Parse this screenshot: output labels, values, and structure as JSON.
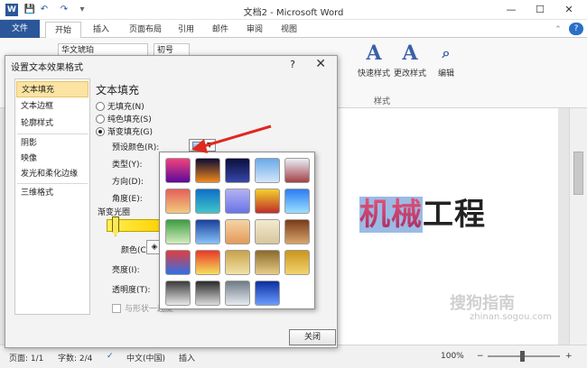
{
  "app": {
    "title": "文档2 - Microsoft Word",
    "word_icon": "W"
  },
  "qat": {
    "save_icon": "save-icon",
    "undo_icon": "undo-icon",
    "redo_icon": "redo-icon"
  },
  "window_controls": {
    "minimize": "—",
    "maximize": "☐",
    "close": "✕"
  },
  "tabs": [
    {
      "label": "文件"
    },
    {
      "label": "开始"
    },
    {
      "label": "插入"
    },
    {
      "label": "页面布局"
    },
    {
      "label": "引用"
    },
    {
      "label": "邮件"
    },
    {
      "label": "审阅"
    },
    {
      "label": "视图"
    }
  ],
  "ribbon": {
    "font_name": "华文琥珀",
    "font_size": "初号",
    "quick_styles": "快速样式",
    "change_styles": "更改样式",
    "edit": "编辑",
    "styles_group": "样式"
  },
  "document": {
    "text_part1": "机械",
    "text_part2": "工程",
    "gradient_colors": [
      "#e3557a",
      "#a52c62"
    ]
  },
  "dialog": {
    "title": "设置文本效果格式",
    "help": "?",
    "close_x": "✕",
    "nav": [
      {
        "label": "文本填充"
      },
      {
        "label": "文本边框"
      },
      {
        "label": "轮廓样式"
      },
      {
        "label": "阴影"
      },
      {
        "label": "映像"
      },
      {
        "label": "发光和柔化边缘"
      },
      {
        "label": "三维格式"
      }
    ],
    "section_title": "文本填充",
    "fill_options": [
      {
        "label": "无填充(N)"
      },
      {
        "label": "纯色填充(S)"
      },
      {
        "label": "渐变填充(G)",
        "selected": true
      }
    ],
    "preset_colors": "预设颜色(R):",
    "type": "类型(Y):",
    "direction": "方向(D):",
    "angle": "角度(E):",
    "gradient_stops": "渐变光圈",
    "color": "颜色(C)",
    "brightness": "亮度(I):",
    "transparency": "透明度(T):",
    "rotate_with_shape": "与形状一起旋",
    "close_button": "关闭"
  },
  "gradient_presets": [
    [
      "#f2427a",
      "#5b0a9b"
    ],
    [
      "#0b0b35",
      "#f08a1d"
    ],
    [
      "#0b0f3e",
      "#3647a8"
    ],
    [
      "#6aaae8",
      "#d3e6fa"
    ],
    [
      "#e9eef7",
      "#a34046"
    ],
    [
      "#e4605a",
      "#f0cb7c"
    ],
    [
      "#0d6fc9",
      "#42c6c8"
    ],
    [
      "#b3b0f2",
      "#6a74e6"
    ],
    [
      "#f2d12b",
      "#c02b2b"
    ],
    [
      "#2b7cf2",
      "#9ae0ff"
    ],
    [
      "#3c9d41",
      "#d5ecbf"
    ],
    [
      "#1b3f9c",
      "#87c3f8"
    ],
    [
      "#f4d3a6",
      "#e49a59"
    ],
    [
      "#f3ead0",
      "#d7c69e"
    ],
    [
      "#7a3b19",
      "#d9a56c"
    ],
    [
      "#e23d3d",
      "#2f70e8"
    ],
    [
      "#e83828",
      "#f6e05c"
    ],
    [
      "#c7a24a",
      "#f2e2a8"
    ],
    [
      "#8a6a2a",
      "#e9cc88"
    ],
    [
      "#c9961b",
      "#f3d470"
    ],
    [
      "#3b3b3b",
      "#e8e8e8"
    ],
    [
      "#2a2a2a",
      "#dcdcdc"
    ],
    [
      "#6f7a86",
      "#e6ebf1"
    ],
    [
      "#0b2f9e",
      "#6b9cff"
    ]
  ],
  "status": {
    "page": "页面: 1/1",
    "words": "字数: 2/4",
    "language": "中文(中国)",
    "mode": "插入",
    "zoom": "100%"
  },
  "watermark": {
    "text": "搜狗指南",
    "url": "zhinan.sogou.com"
  }
}
